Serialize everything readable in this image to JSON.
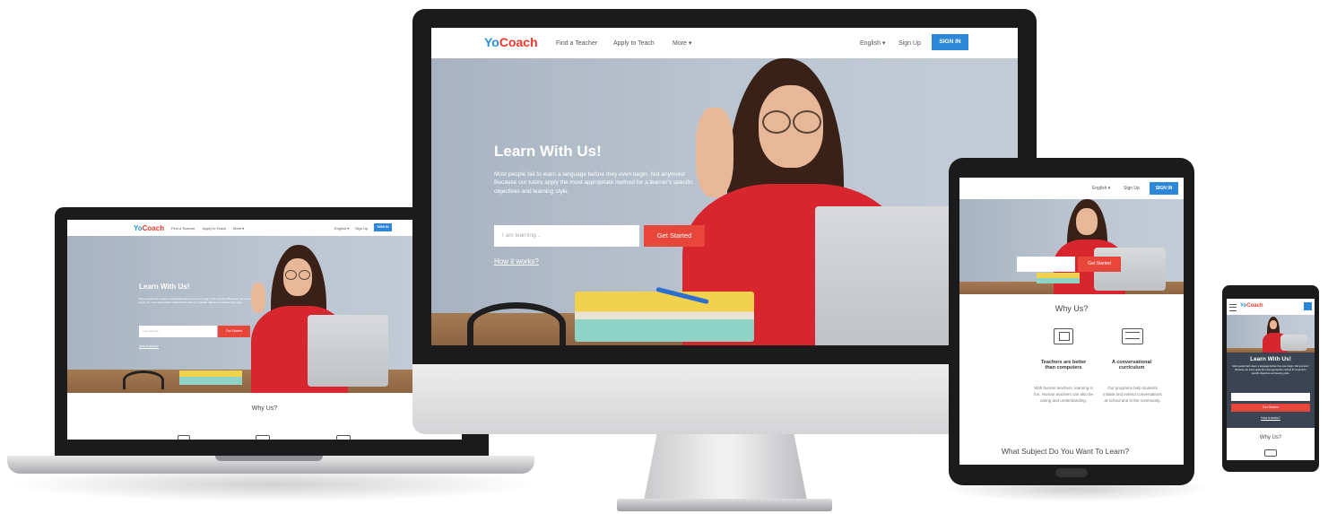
{
  "brand": {
    "logo_yo": "Yo",
    "logo_coach": "Coach"
  },
  "nav": {
    "find_teacher": "Find a Teacher",
    "apply_teach": "Apply to Teach",
    "more": "More ▾",
    "language": "English ▾",
    "sign_up": "Sign Up",
    "sign_in": "SIGN IN"
  },
  "hero": {
    "title": "Learn With Us!",
    "text": "Most people fail to learn a language before they even begin. Not anymore! Because our tutors apply the most appropriate method for a learner's specific objectives and learning style.",
    "input_placeholder": "I am learning...",
    "button": "Get Started",
    "how_link": "How it works?"
  },
  "why": {
    "title": "Why Us?",
    "feature1_title": "Teachers are better than computers",
    "feature1_text": "With human teachers, learning is fun. Human teachers can also be caring and understanding.",
    "feature2_title": "A conversational curriculum",
    "feature2_text": "Our programs help students initiate and extend conversations at school and in the community."
  },
  "subject": {
    "title": "What Subject Do You Want To Learn?"
  },
  "colors": {
    "accent": "#e8463a",
    "brand_blue": "#2c87d8",
    "sweater": "#d8262f"
  }
}
